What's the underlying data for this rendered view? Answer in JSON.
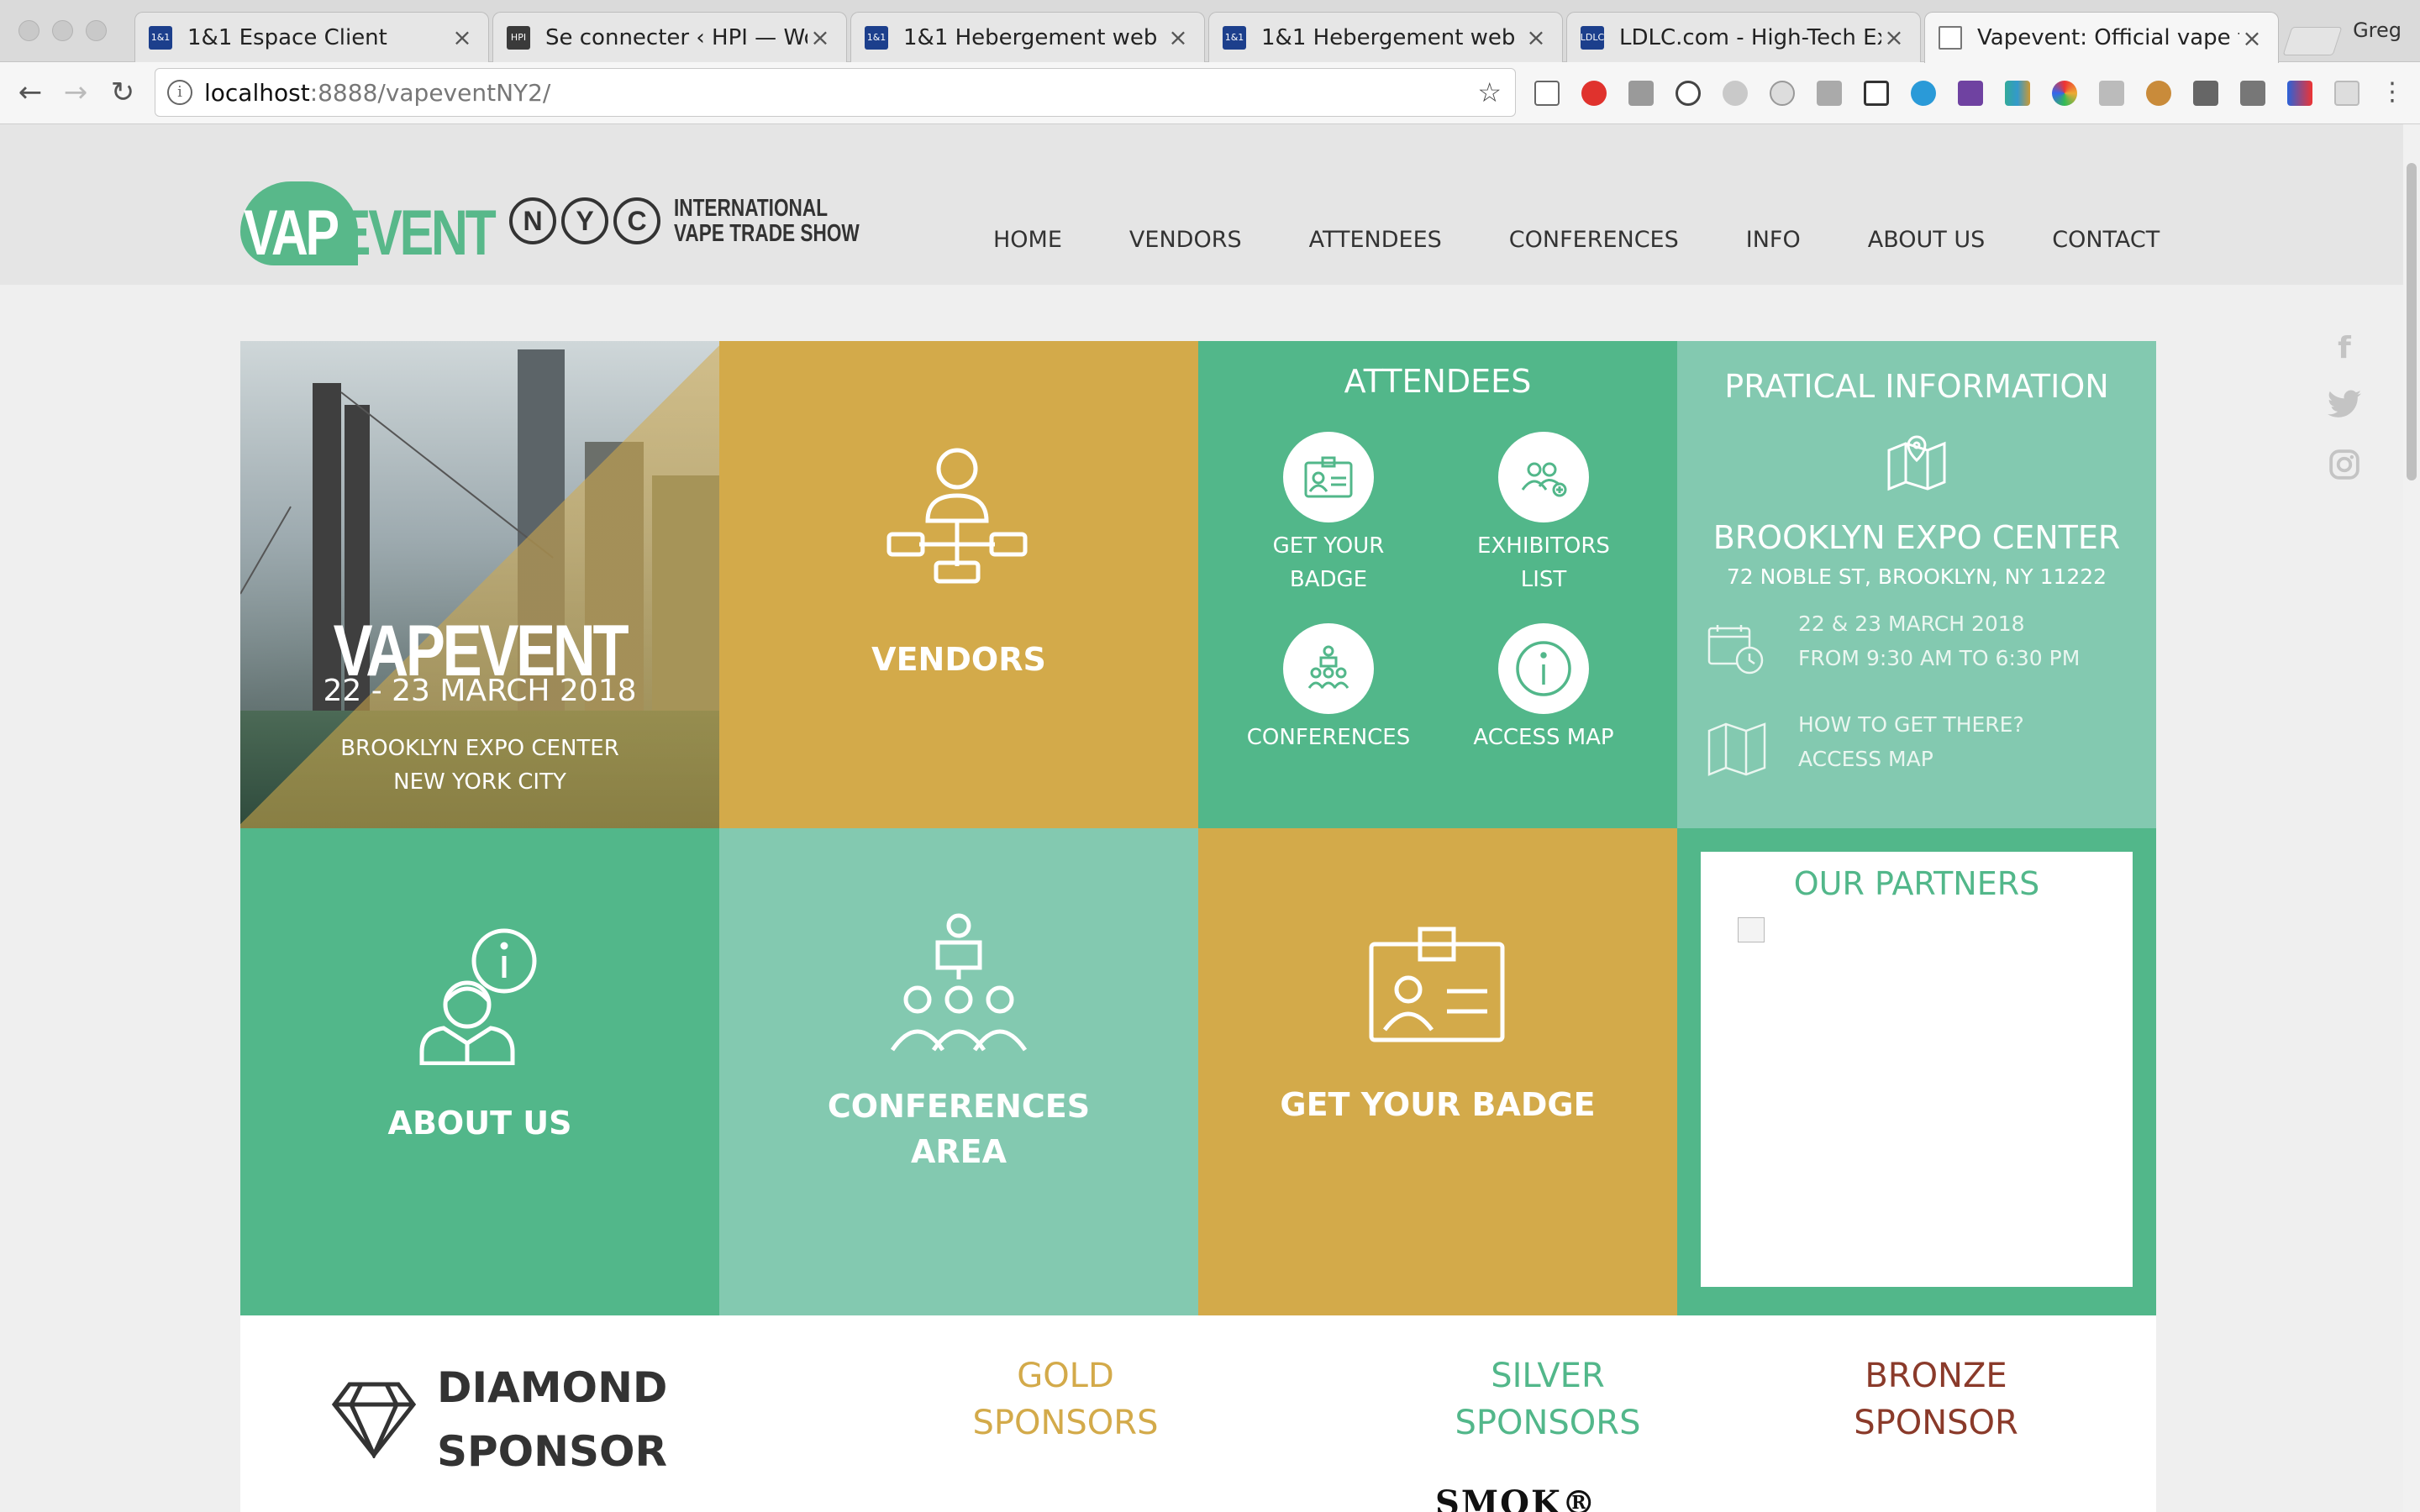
{
  "browser": {
    "tabs": [
      {
        "title": "1&1 Espace Client",
        "favicon": "1&1",
        "active": false
      },
      {
        "title": "Se connecter ‹ HPI — Word",
        "favicon": "HPI",
        "active": false
      },
      {
        "title": "1&1 Hebergement web",
        "favicon": "1&1",
        "active": false
      },
      {
        "title": "1&1 Hebergement web",
        "favicon": "1&1",
        "active": false
      },
      {
        "title": "LDLC.com - High-Tech Expe",
        "favicon": "LDLC",
        "active": false
      },
      {
        "title": "Vapevent: Official vape trad",
        "favicon": "page",
        "active": true
      }
    ],
    "profile_name": "Greg",
    "url_host": "localhost",
    "url_rest": ":8888/vapeventNY2/"
  },
  "header": {
    "logo_vap": "VAP",
    "logo_event": "EVENT",
    "logo_nyc": [
      "N",
      "Y",
      "C"
    ],
    "logo_tagline_1": "INTERNATIONAL",
    "logo_tagline_2": "VAPE TRADE SHOW",
    "nav": [
      "HOME",
      "VENDORS",
      "ATTENDEES",
      "CONFERENCES",
      "INFO",
      "ABOUT US",
      "CONTACT"
    ]
  },
  "hero": {
    "logo": "VAPEVENT",
    "date": "22 - 23 MARCH 2018",
    "venue": "BROOKLYN EXPO CENTER",
    "city": "NEW YORK CITY"
  },
  "tiles": {
    "vendors": "VENDORS",
    "attendees_title": "ATTENDEES",
    "attendees_items": [
      {
        "label": "GET YOUR\nBADGE",
        "icon": "badge-icon"
      },
      {
        "label": "EXHIBITORS\nLIST",
        "icon": "exhibitors-icon"
      },
      {
        "label": "CONFERENCES",
        "icon": "conference-icon"
      },
      {
        "label": "ACCESS MAP",
        "icon": "info-icon"
      }
    ],
    "info_title": "PRATICAL INFORMATION",
    "info_venue": "BROOKLYN EXPO CENTER",
    "info_address": "72 NOBLE ST, BROOKLYN, NY 11222",
    "info_date_1": "22 & 23 MARCH 2018",
    "info_date_2": "FROM 9:30 AM TO 6:30 PM",
    "info_access_1": "HOW TO GET THERE?",
    "info_access_2": "ACCESS MAP",
    "about": "ABOUT US",
    "conferences_1": "CONFERENCES",
    "conferences_2": "AREA",
    "badge": "GET YOUR BADGE",
    "partners_title": "OUR PARTNERS"
  },
  "sponsors": {
    "diamond_1": "DIAMOND",
    "diamond_2": "SPONSOR",
    "gold": "GOLD\nSPONSORS",
    "silver": "SILVER\nSPONSORS",
    "bronze": "BRONZE\nSPONSOR",
    "smok": "SMOK®"
  },
  "colors": {
    "green": "#52b78a",
    "gold": "#d3aa4a",
    "teal": "#83c9b0",
    "bronze": "#8a3a2a"
  }
}
